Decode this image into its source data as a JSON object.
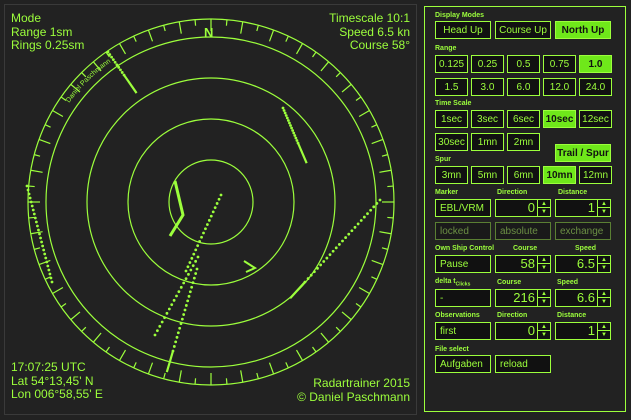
{
  "radar": {
    "mode": "Mode",
    "range": "Range 1sm",
    "rings": "Rings 0.25sm",
    "timescale": "Timescale 10:1",
    "speed": "Speed 6.5 kn",
    "course": "Course 58°",
    "time": "17:07:25 UTC",
    "lat": "Lat 54°13,45' N",
    "lon": "Lon 006°58,55' E",
    "product": "Radartrainer  2015",
    "copyright": "© Daniel Paschmann",
    "north_label": "N",
    "ring_author": "Daniel Paschmann"
  },
  "panel": {
    "display_modes": {
      "label": "Display Modes",
      "buttons": [
        "Head Up",
        "Course Up",
        "North Up"
      ],
      "active": "North Up"
    },
    "range": {
      "label": "Range",
      "buttons": [
        "0.125",
        "0.25",
        "0.5",
        "0.75",
        "1.0",
        "1.5",
        "3.0",
        "6.0",
        "12.0",
        "24.0"
      ],
      "active": "1.0"
    },
    "time_scale": {
      "label": "Time Scale",
      "buttons": [
        "1sec",
        "3sec",
        "6sec",
        "10sec",
        "12sec",
        "30sec",
        "1mn",
        "2mn"
      ],
      "active": "10sec"
    },
    "trail": {
      "label": "Trail / Spur"
    },
    "spur": {
      "label": "Spur",
      "buttons": [
        "3mn",
        "5mn",
        "6mn",
        "10mn",
        "12mn"
      ],
      "active": "10mn"
    },
    "marker": {
      "label": "Marker",
      "direction_label": "Direction",
      "distance_label": "Distance",
      "button": "EBL/VRM",
      "direction": "0",
      "distance": "1",
      "locked": "locked",
      "absolute": "absolute",
      "exchange": "exchange"
    },
    "own_ship": {
      "label": "Own Ship Control",
      "course_label": "Course",
      "speed_label": "Speed",
      "button": "Pause",
      "course": "58",
      "speed": "6.5"
    },
    "delta": {
      "label": "delta t",
      "label_sub": "Clicks",
      "course_label": "Course",
      "speed_label": "Speed",
      "button": "-",
      "course": "216",
      "speed": "6.6"
    },
    "observations": {
      "label": "Observations",
      "direction_label": "Direction",
      "distance_label": "Distance",
      "button": "first",
      "direction": "0",
      "distance": "1"
    },
    "file_select": {
      "label": "File select",
      "aufgaben": "Aufgaben",
      "reload": "reload"
    }
  },
  "colors": {
    "background": "#222222",
    "accent": "#9cff3c",
    "active_fill": "#6fe81a"
  }
}
